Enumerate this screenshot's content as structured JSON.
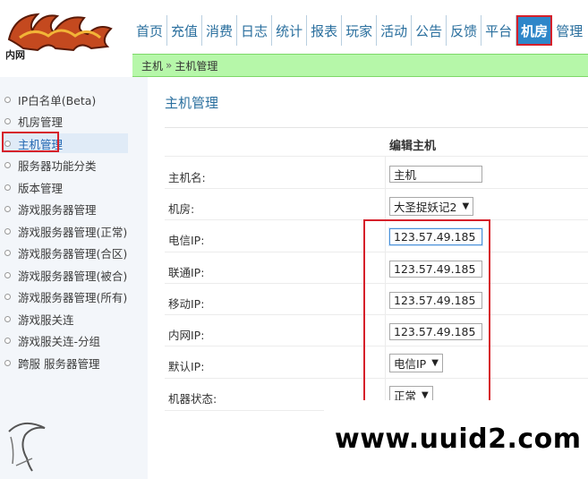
{
  "app": {
    "logo_text": "内网"
  },
  "nav": {
    "items": [
      {
        "label": "首页"
      },
      {
        "label": "充值"
      },
      {
        "label": "消费"
      },
      {
        "label": "日志"
      },
      {
        "label": "统计"
      },
      {
        "label": "报表"
      },
      {
        "label": "玩家"
      },
      {
        "label": "活动"
      },
      {
        "label": "公告"
      },
      {
        "label": "反馈"
      },
      {
        "label": "平台"
      },
      {
        "label": "机房",
        "active": true
      },
      {
        "label": "管理"
      }
    ]
  },
  "breadcrumb": {
    "root": "主机",
    "separator": "»",
    "current": "主机管理"
  },
  "sidebar": {
    "items": [
      {
        "label": "IP白名单(Beta)"
      },
      {
        "label": "机房管理"
      },
      {
        "label": "主机管理",
        "active": true
      },
      {
        "label": "服务器功能分类"
      },
      {
        "label": "版本管理"
      },
      {
        "label": "游戏服务器管理"
      },
      {
        "label": "游戏服务器管理(正常)"
      },
      {
        "label": "游戏服务器管理(合区)"
      },
      {
        "label": "游戏服务器管理(被合)"
      },
      {
        "label": "游戏服务器管理(所有)"
      },
      {
        "label": "游戏服关连"
      },
      {
        "label": "游戏服关连-分组"
      },
      {
        "label": "跨服 服务器管理"
      }
    ]
  },
  "main": {
    "title": "主机管理",
    "form_heading": "编辑主机",
    "fields": {
      "hostname": {
        "label": "主机名:",
        "value": "主机"
      },
      "room": {
        "label": "机房:",
        "value": "大圣捉妖记2"
      },
      "telecom_ip": {
        "label": "电信IP:",
        "value": "123.57.49.185"
      },
      "unicom_ip": {
        "label": "联通IP:",
        "value": "123.57.49.185"
      },
      "mobile_ip": {
        "label": "移动IP:",
        "value": "123.57.49.185"
      },
      "intranet_ip": {
        "label": "内网IP:",
        "value": "123.57.49.185"
      },
      "default_ip": {
        "label": "默认IP:",
        "value": "电信IP"
      },
      "machine_status": {
        "label": "机器状态:",
        "value": "正常"
      }
    }
  },
  "watermark": {
    "text": "www.uuid2.com"
  },
  "colors": {
    "accent": "#2e86c9",
    "highlight": "#d6202a",
    "breadcrumb_bg": "#b6f7a9",
    "title": "#2a6f9e"
  }
}
